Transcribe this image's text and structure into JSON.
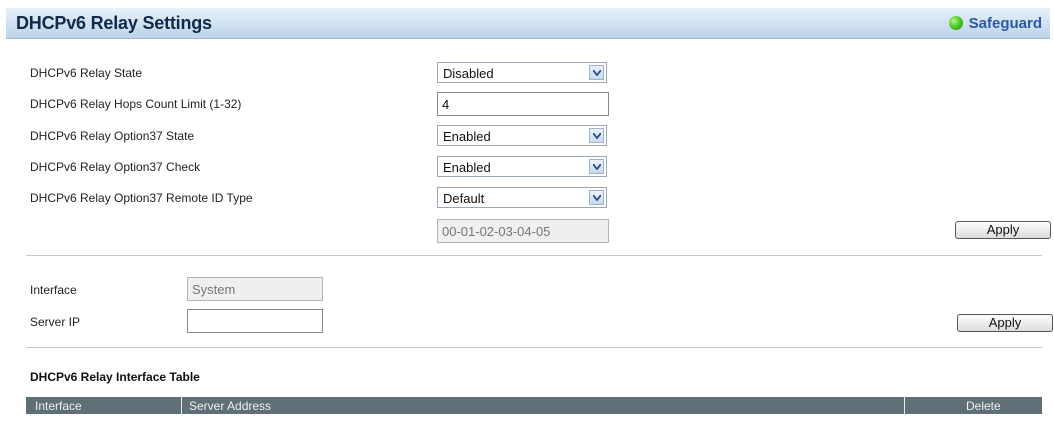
{
  "header": {
    "title": "DHCPv6 Relay Settings",
    "safeguard_label": "Safeguard"
  },
  "form": {
    "relay_state": {
      "label": "DHCPv6 Relay State",
      "value": "Disabled"
    },
    "hops_limit": {
      "label": "DHCPv6 Relay Hops Count Limit (1-32)",
      "value": "4"
    },
    "opt37_state": {
      "label": "DHCPv6 Relay Option37 State",
      "value": "Enabled"
    },
    "opt37_check": {
      "label": "DHCPv6 Relay Option37 Check",
      "value": "Enabled"
    },
    "opt37_remote_id_type": {
      "label": "DHCPv6 Relay Option37 Remote ID Type",
      "value": "Default"
    },
    "remote_id_value": "00-01-02-03-04-05",
    "apply_label": "Apply"
  },
  "server_form": {
    "interface_label": "Interface",
    "interface_value": "System",
    "server_ip_label": "Server IP",
    "server_ip_value": "",
    "apply_label": "Apply"
  },
  "table": {
    "title": "DHCPv6 Relay Interface Table",
    "columns": [
      "Interface",
      "Server Address",
      "Delete"
    ]
  },
  "colors": {
    "title_text": "#0f2a4a",
    "safeguard_text": "#2b59a6",
    "table_header_bg": "#5f6f76"
  }
}
